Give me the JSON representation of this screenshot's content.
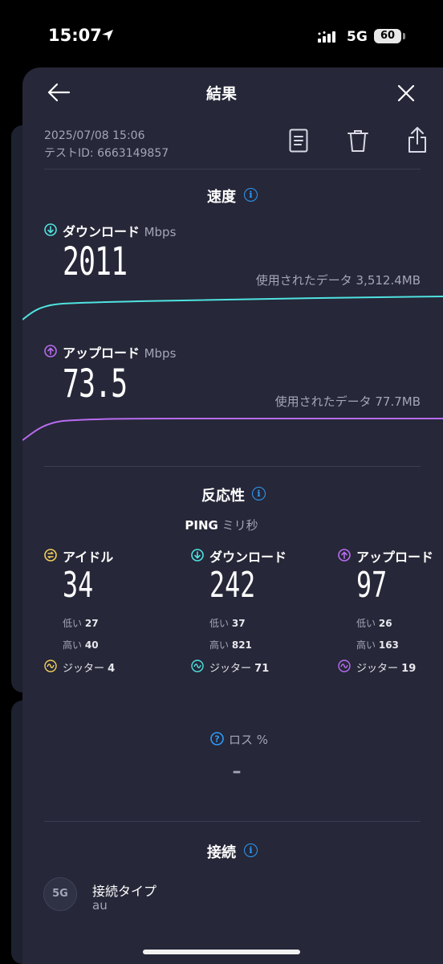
{
  "status_bar": {
    "time": "15:07",
    "network": "5G",
    "battery": "60"
  },
  "header": {
    "title": "結果"
  },
  "meta": {
    "date": "2025/07/08 15:06",
    "test_id": "テストID: 6663149857"
  },
  "speed": {
    "title": "速度",
    "download": {
      "label": "ダウンロード",
      "unit": "Mbps",
      "value": "2011",
      "data_used": "使用されたデータ 3,512.4MB",
      "color": "#4fe3e0"
    },
    "upload": {
      "label": "アップロード",
      "unit": "Mbps",
      "value": "73.5",
      "data_used": "使用されたデータ 77.7MB",
      "color": "#b86cf0"
    }
  },
  "responsiveness": {
    "title": "反応性",
    "ping_label": "PING",
    "ping_unit": "ミリ秒",
    "columns": [
      {
        "label": "アイドル",
        "value": "34",
        "low_label": "低い",
        "low": "27",
        "high_label": "高い",
        "high": "40",
        "jitter_label": "ジッター",
        "jitter": "4",
        "color": "#f2cf5c"
      },
      {
        "label": "ダウンロード",
        "value": "242",
        "low_label": "低い",
        "low": "37",
        "high_label": "高い",
        "high": "821",
        "jitter_label": "ジッター",
        "jitter": "71",
        "color": "#4fe3e0"
      },
      {
        "label": "アップロード",
        "value": "97",
        "low_label": "低い",
        "low": "26",
        "high_label": "高い",
        "high": "163",
        "jitter_label": "ジッター",
        "jitter": "19",
        "color": "#b86cf0"
      }
    ],
    "loss_label": "ロス %",
    "loss_value": "–"
  },
  "connection": {
    "title": "接続",
    "type_badge": "5G",
    "type_label": "接続タイプ",
    "type_value": "au"
  },
  "colors": {
    "accent": "#2d9cfa",
    "sheet": "#262738"
  }
}
